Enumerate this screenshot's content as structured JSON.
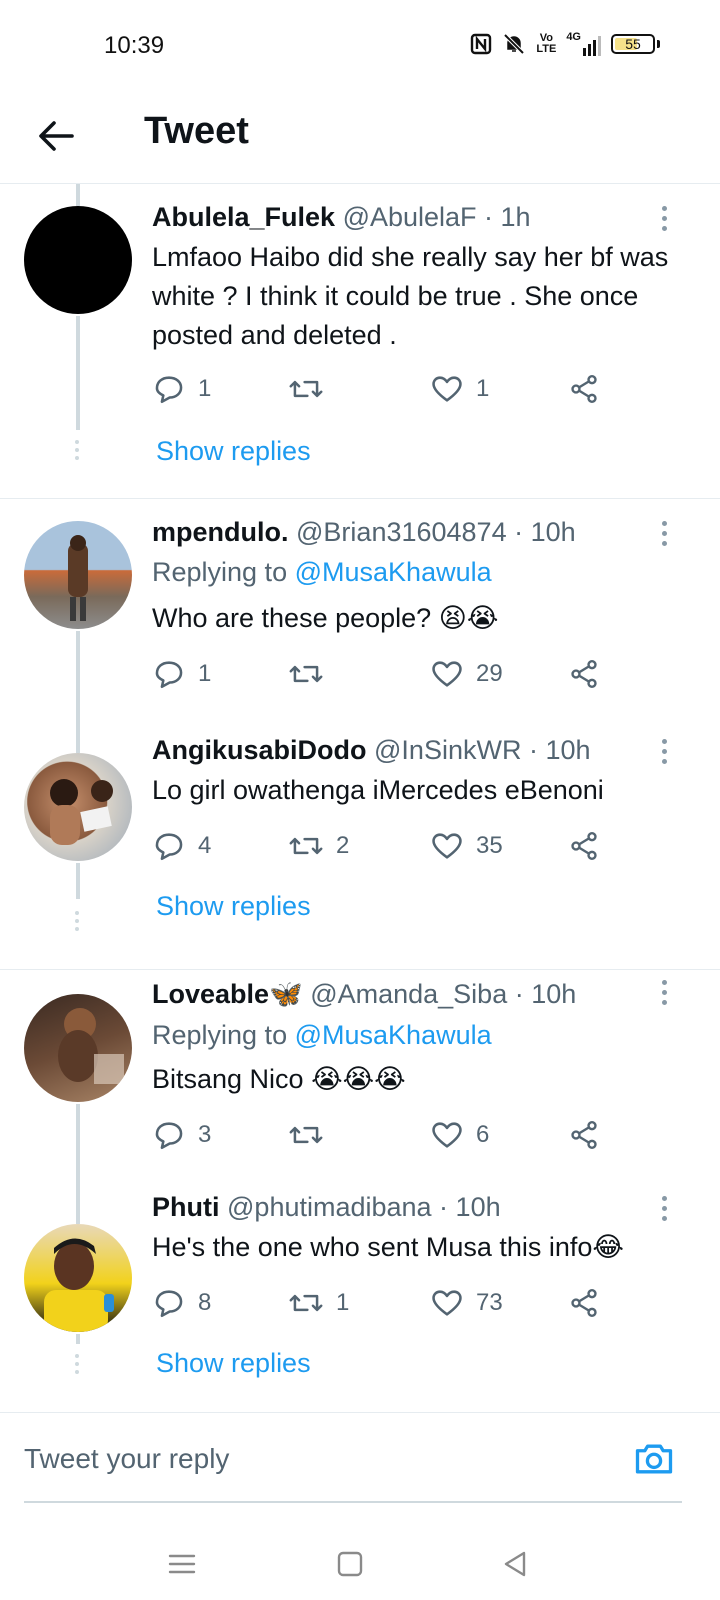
{
  "status_bar": {
    "time": "10:39",
    "icons": [
      "nfc-icon",
      "mute-icon",
      "volte-icon",
      "signal-4g-icon"
    ],
    "volte_label": "Vo LTE",
    "network_label": "4G",
    "battery": "55"
  },
  "header": {
    "title": "Tweet"
  },
  "tweets": [
    {
      "name": "Abulela_Fulek",
      "meta": "@AbulelaF · 1h",
      "replying_prefix": "",
      "replying_handle": "",
      "text": "Lmfaoo Haibo did she really say her bf was white ? I think it could be true . She once posted and deleted .",
      "replies": "1",
      "retweets": "",
      "likes": "1",
      "show_replies": "Show replies",
      "avatar_color": "#000000"
    },
    {
      "name": "mpendulo.",
      "meta": "@Brian31604874 · 10h",
      "replying_prefix": "Replying to",
      "replying_handle": "@MusaKhawula",
      "text": "Who are these people? 😫😭",
      "replies": "1",
      "retweets": "",
      "likes": "29",
      "show_replies": "",
      "avatar_color": "#b9c7d6"
    },
    {
      "name": "AngikusabiDodo",
      "meta": "@InSinkWR · 10h",
      "replying_prefix": "",
      "replying_handle": "",
      "text": "Lo girl owathenga iMercedes eBenoni",
      "replies": "4",
      "retweets": "2",
      "likes": "35",
      "show_replies": "Show replies",
      "avatar_color": "#c58f6c"
    },
    {
      "name": "Loveable🦋",
      "meta": "@Amanda_Siba · 10h",
      "replying_prefix": "Replying to",
      "replying_handle": "@MusaKhawula",
      "text": "Bitsang Nico 😭😭😭",
      "replies": "3",
      "retweets": "",
      "likes": "6",
      "show_replies": "",
      "avatar_color": "#6b4a36"
    },
    {
      "name": "Phuti",
      "meta": "@phutimadibana · 10h",
      "replying_prefix": "",
      "replying_handle": "",
      "text": "He's the one who sent Musa this info😂",
      "replies": "8",
      "retweets": "1",
      "likes": "73",
      "show_replies": "Show replies",
      "avatar_color": "#f2d21b"
    }
  ],
  "reply_bar": {
    "placeholder": "Tweet your reply"
  },
  "nav_bar": {
    "buttons": [
      "menu-icon",
      "home-square-icon",
      "back-triangle-icon"
    ]
  },
  "colors": {
    "accent": "#1d9bf0",
    "text": "#0f1419",
    "muted": "#536471",
    "divider": "#e6ecf0",
    "thread": "#cfd9de"
  }
}
